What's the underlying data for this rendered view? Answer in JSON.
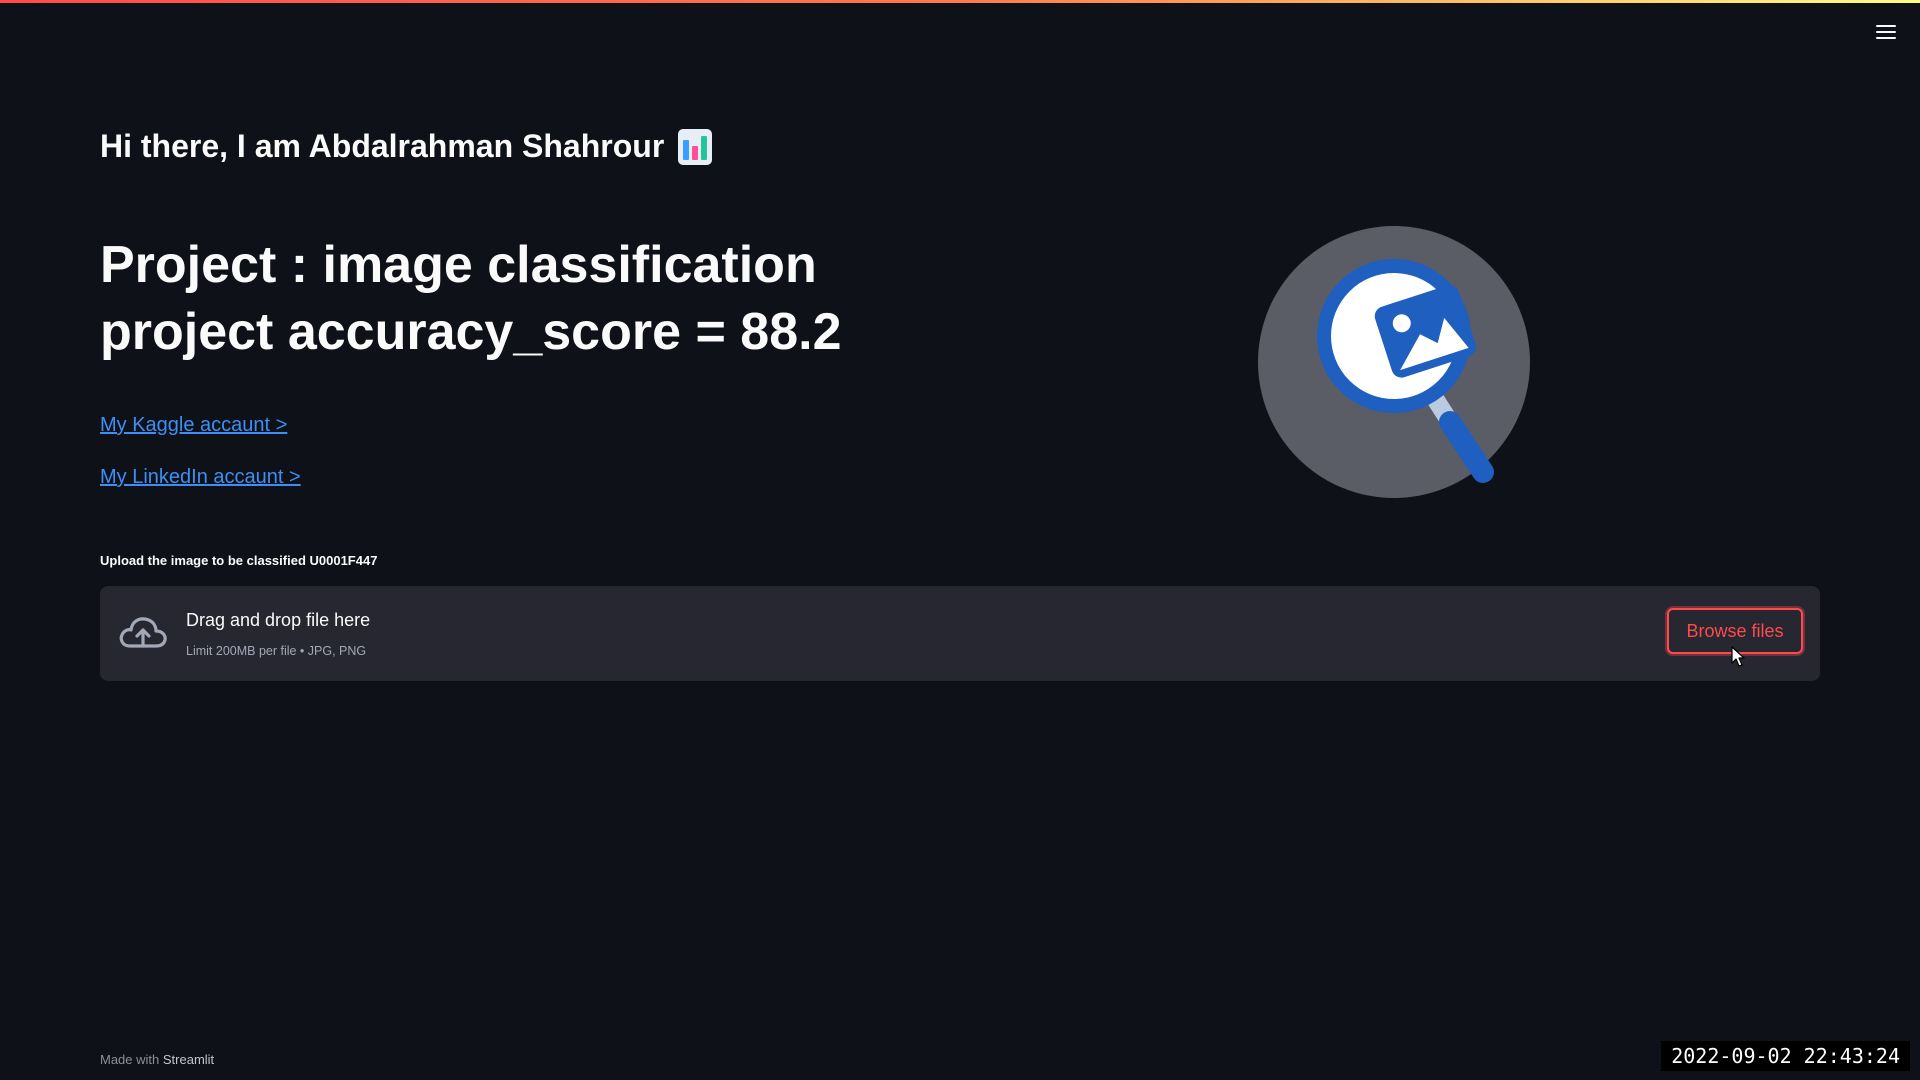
{
  "header": {
    "greeting": "Hi there, I am Abdalrahman Shahrour",
    "greeting_icon": "bar-chart-emoji",
    "accent_gradient": [
      "#ff4b4b",
      "#fffd80"
    ],
    "menu_icon": "hamburger-icon"
  },
  "main": {
    "title_line1": "Project : image classification",
    "title_line2": "project accuracy_score = 88.2",
    "links": {
      "kaggle": "My Kaggle accaunt >",
      "linkedin": "My LinkedIn accaunt >"
    },
    "logo_icon": "image-search-magnifier-logo"
  },
  "uploader": {
    "label": "Upload the image to be classified U0001F447",
    "drop_title": "Drag and drop file here",
    "limit_text": "Limit 200MB per file • JPG, PNG",
    "browse_label": "Browse files",
    "upload_icon": "cloud-upload-icon",
    "accent_color": "#ff4b4b"
  },
  "footer": {
    "made_with": "Made with",
    "brand": "Streamlit"
  },
  "overlay": {
    "timestamp": "2022-09-02 22:43:24"
  },
  "colors": {
    "background": "#0e1117",
    "panel": "#262730",
    "link": "#3d8ff5",
    "logo_blue": "#1f5fbf",
    "logo_circle": "#5a5d66"
  }
}
